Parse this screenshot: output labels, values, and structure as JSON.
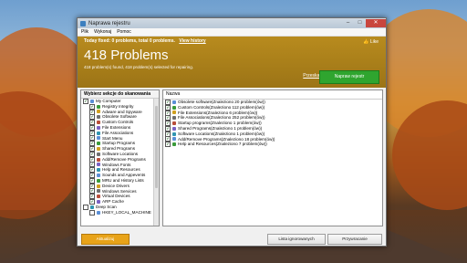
{
  "window": {
    "title": "Naprawa rejestru"
  },
  "menu": [
    "Plik",
    "Wykonaj",
    "Pomoc"
  ],
  "banner": {
    "today_text": "Today fixed: 0 problems, total 0 problems.",
    "history_link": "View history",
    "problems_count": "418 Problems",
    "summary": "418 problem(s) found, 418 problem(s) selected for repairing.",
    "like": "Like",
    "scan_link": "Przeskanuj",
    "repair_button": "Napraw rejestr"
  },
  "left_pane": {
    "header": "Wybierz sekcje do skanowania",
    "items": [
      {
        "label": "My Computer",
        "checked": true,
        "indent": 0
      },
      {
        "label": "Registry Integrity",
        "checked": true,
        "indent": 1
      },
      {
        "label": "Adware and Spyware",
        "checked": true,
        "indent": 1
      },
      {
        "label": "Obsolete Software",
        "checked": true,
        "indent": 1
      },
      {
        "label": "Custom Controls",
        "checked": true,
        "indent": 1
      },
      {
        "label": "File Extensions",
        "checked": true,
        "indent": 1
      },
      {
        "label": "File Associations",
        "checked": true,
        "indent": 1
      },
      {
        "label": "Start Menu",
        "checked": true,
        "indent": 1
      },
      {
        "label": "Startup Programs",
        "checked": true,
        "indent": 1
      },
      {
        "label": "Shared Programs",
        "checked": true,
        "indent": 1
      },
      {
        "label": "Software Locations",
        "checked": true,
        "indent": 1
      },
      {
        "label": "Add/Remove Programs",
        "checked": true,
        "indent": 1
      },
      {
        "label": "Windows Fonts",
        "checked": true,
        "indent": 1
      },
      {
        "label": "Help and Resources",
        "checked": true,
        "indent": 1
      },
      {
        "label": "Sounds and Appevents",
        "checked": true,
        "indent": 1
      },
      {
        "label": "MRU and History Lists",
        "checked": true,
        "indent": 1
      },
      {
        "label": "Device Drivers",
        "checked": true,
        "indent": 1
      },
      {
        "label": "Windows Services",
        "checked": true,
        "indent": 1
      },
      {
        "label": "Virtual Devices",
        "checked": true,
        "indent": 1
      },
      {
        "label": "ARP Cache",
        "checked": true,
        "indent": 1
      },
      {
        "label": "Deep Scan",
        "checked": false,
        "indent": 0
      },
      {
        "label": "HKEY_LOCAL_MACHINE",
        "checked": false,
        "indent": 1
      }
    ]
  },
  "right_pane": {
    "header": "Nazwa",
    "rows": [
      "Obsolete software(Znaleziono 20 problem(ów))",
      "Custom Controls(Znaleziono 112 problem(ów))",
      "File Extensions(Znaleziono 6 problem(ów))",
      "File Associations(Znaleziono 252 problem(ów))",
      "Startup programs(Znaleziono 1 problem(ów))",
      "Shared Programs(Znaleziono 1 problem(ów))",
      "Software Locations(Znaleziono 1 problem(ów))",
      "Add/Remove Programs(Znaleziono 18 problem(ów))",
      "Help and Resources(Znaleziono 7 problem(ów))"
    ]
  },
  "footer": {
    "update_button": "Aktualizuj",
    "ignored_button": "Lista ignorowanych",
    "restore_button": "Przywracanie"
  },
  "colors": {
    "banner": "#b88b1e",
    "repair": "#2fa52f",
    "update": "#e8a319"
  }
}
